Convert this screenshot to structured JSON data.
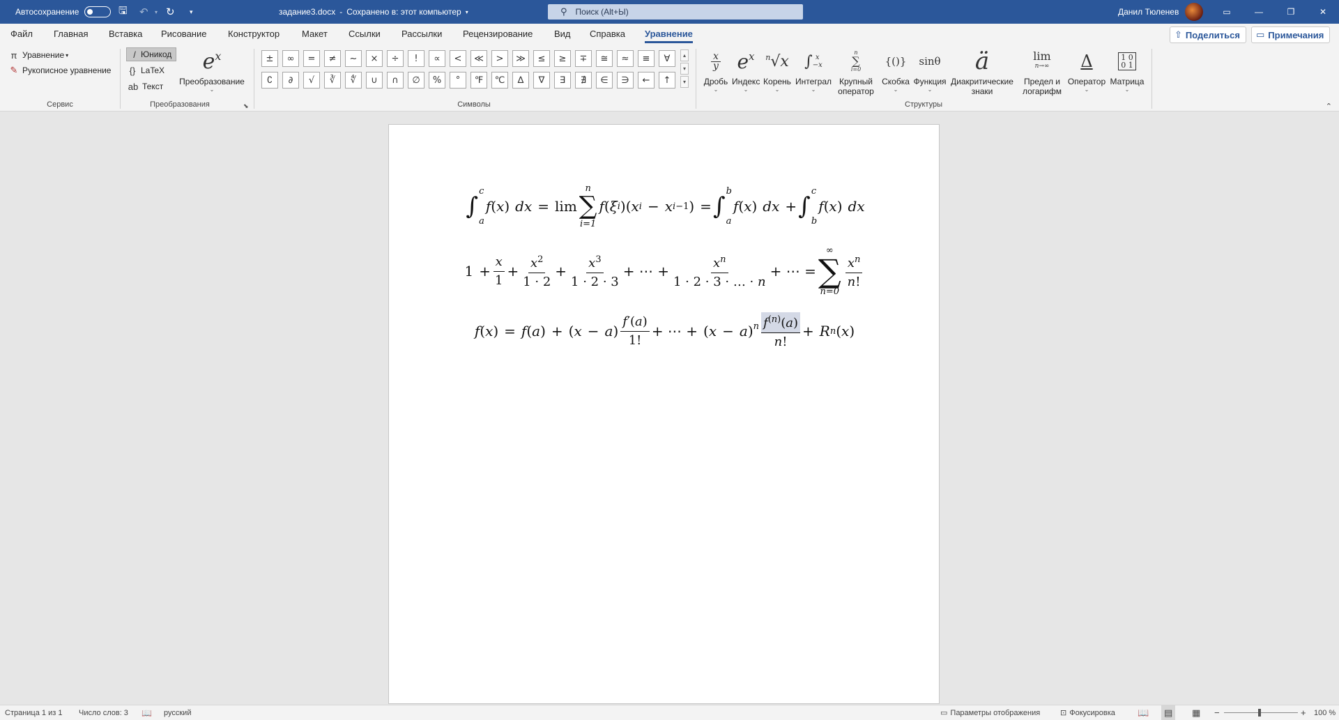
{
  "titlebar": {
    "autosave_label": "Автосохранение",
    "document_title": "задание3.docx",
    "save_status": "Сохранено в: этот компьютер",
    "search_placeholder": "Поиск (Alt+Ы)",
    "user_name": "Данил Тюленев"
  },
  "menu": {
    "tabs": [
      "Файл",
      "Главная",
      "Вставка",
      "Рисование",
      "Конструктор",
      "Макет",
      "Ссылки",
      "Рассылки",
      "Рецензирование",
      "Вид",
      "Справка",
      "Уравнение"
    ],
    "active_tab": "Уравнение",
    "share_label": "Поделиться",
    "comments_label": "Примечания"
  },
  "ribbon": {
    "service": {
      "group_label": "Сервис",
      "equation_label": "Уравнение",
      "ink_equation_label": "Рукописное уравнение"
    },
    "conversions": {
      "group_label": "Преобразования",
      "unicode_label": "Юникод",
      "latex_label": "LaTeX",
      "text_label": "Текст",
      "convert_label": "Преобразование"
    },
    "symbols": {
      "group_label": "Символы",
      "row1": [
        "±",
        "∞",
        "=",
        "≠",
        "~",
        "×",
        "÷",
        "!",
        "∝",
        "<",
        "≪",
        ">",
        "≫",
        "≤",
        "≥",
        "∓",
        "≅",
        "≈",
        "≡",
        "∀"
      ],
      "row2": [
        "∁",
        "∂",
        "√",
        "∛",
        "∜",
        "∪",
        "∩",
        "∅",
        "%",
        "°",
        "℉",
        "℃",
        "∆",
        "∇",
        "∃",
        "∄",
        "∈",
        "∋",
        "←",
        "↑"
      ]
    },
    "structures": {
      "group_label": "Структуры",
      "items": [
        {
          "glyph": "x/y",
          "label": "Дробь"
        },
        {
          "glyph": "eˣ",
          "label": "Индекс"
        },
        {
          "glyph": "ⁿ√x",
          "label": "Корень"
        },
        {
          "glyph": "∫",
          "label": "Интеграл"
        },
        {
          "glyph": "∑",
          "label": "Крупный оператор"
        },
        {
          "glyph": "{()}",
          "label": "Скобка"
        },
        {
          "glyph": "sinθ",
          "label": "Функция"
        },
        {
          "glyph": "ä",
          "label": "Диакритические знаки"
        },
        {
          "glyph": "lim",
          "label": "Предел и логарифм"
        },
        {
          "glyph": "Δ",
          "label": "Оператор"
        },
        {
          "glyph": "[10/01]",
          "label": "Матрица"
        }
      ]
    }
  },
  "status": {
    "page": "Страница 1 из 1",
    "words": "Число слов: 3",
    "language": "русский",
    "display_settings": "Параметры отображения",
    "focus": "Фокусировка",
    "zoom": "100 %"
  }
}
